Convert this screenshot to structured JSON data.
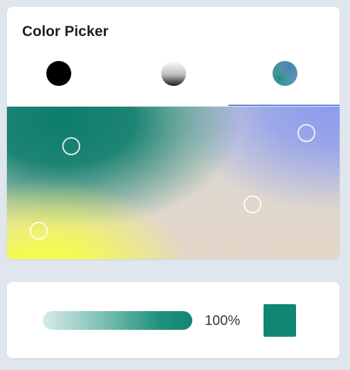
{
  "panel": {
    "title": "Color Picker"
  },
  "tabs": [
    {
      "name": "solid",
      "icon": "black-circle-icon",
      "color": "#000000",
      "selected": false
    },
    {
      "name": "grayscale",
      "icon": "gray-gradient-circle-icon",
      "selected": false
    },
    {
      "name": "gradient",
      "icon": "multicolor-gradient-circle-icon",
      "selected": true
    }
  ],
  "gradient_canvas": {
    "colors": [
      "#0d7d6c",
      "#8b9bee",
      "#f7ff41",
      "#e3d6c8"
    ],
    "handles": [
      {
        "name": "green-stop"
      },
      {
        "name": "periwinkle-stop"
      },
      {
        "name": "beige-stop"
      },
      {
        "name": "yellow-stop"
      }
    ]
  },
  "opacity": {
    "value_label": "100%",
    "value": 1.0,
    "color": "#108672"
  },
  "selected_color": "#118772"
}
